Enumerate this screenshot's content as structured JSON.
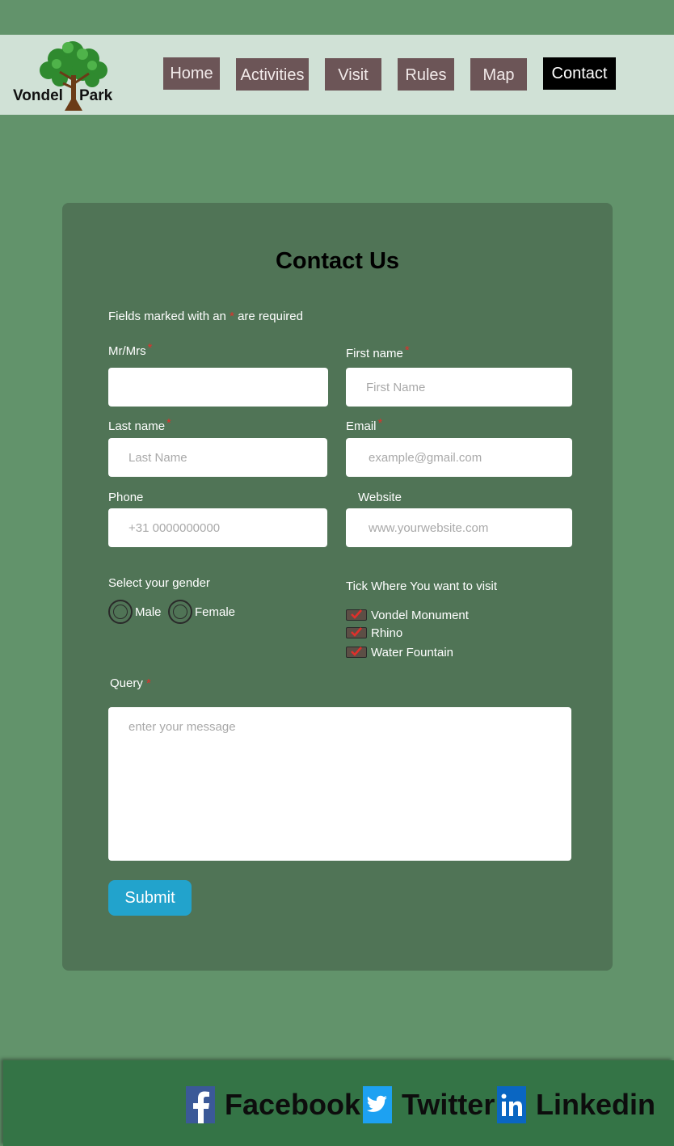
{
  "header": {
    "logo": {
      "word1": "Vondel",
      "word2": "Park"
    },
    "nav": [
      {
        "label": "Home"
      },
      {
        "label": "Activities"
      },
      {
        "label": "Visit"
      },
      {
        "label": "Rules"
      },
      {
        "label": "Map"
      },
      {
        "label": "Contact"
      }
    ]
  },
  "form": {
    "title": "Contact Us",
    "required_note": {
      "before": "Fields marked with an",
      "star": "*",
      "after": "are required"
    },
    "fields": {
      "mr_mrs": {
        "label": "Mr/Mrs",
        "placeholder": ""
      },
      "first_name": {
        "label": "First name",
        "placeholder": "First Name"
      },
      "last_name": {
        "label": "Last name",
        "placeholder": "Last Name"
      },
      "email": {
        "label": "Email",
        "placeholder": "example@gmail.com"
      },
      "phone": {
        "label": "Phone",
        "placeholder": "+31 0000000000"
      },
      "website": {
        "label": "Website",
        "placeholder": "www.yourwebsite.com"
      },
      "query": {
        "label": "Query",
        "placeholder": "enter your message"
      }
    },
    "required_star": "*",
    "gender": {
      "label": "Select your gender",
      "options": [
        "Male",
        "Female"
      ]
    },
    "visit": {
      "label": "Tick Where You want to visit",
      "options": [
        "Vondel Monument",
        "Rhino",
        "Water Fountain"
      ]
    },
    "submit_label": "Submit"
  },
  "footer": {
    "social": [
      {
        "label": "Facebook",
        "icon": "facebook-icon",
        "color": "#3b5998"
      },
      {
        "label": "Twitter",
        "icon": "twitter-icon",
        "color": "#1da1f2"
      },
      {
        "label": "Linkedin",
        "icon": "linkedin-icon",
        "color": "#0a66c2"
      }
    ]
  },
  "colors": {
    "page_bg": "#62936b",
    "header_bg": "#d0e1d6",
    "card_bg": "#507456",
    "nav_bg": "#6c5557",
    "nav_active_bg": "#000000",
    "submit_bg": "#22a3cc",
    "footer_bg": "#347446",
    "required": "#e0302b"
  }
}
